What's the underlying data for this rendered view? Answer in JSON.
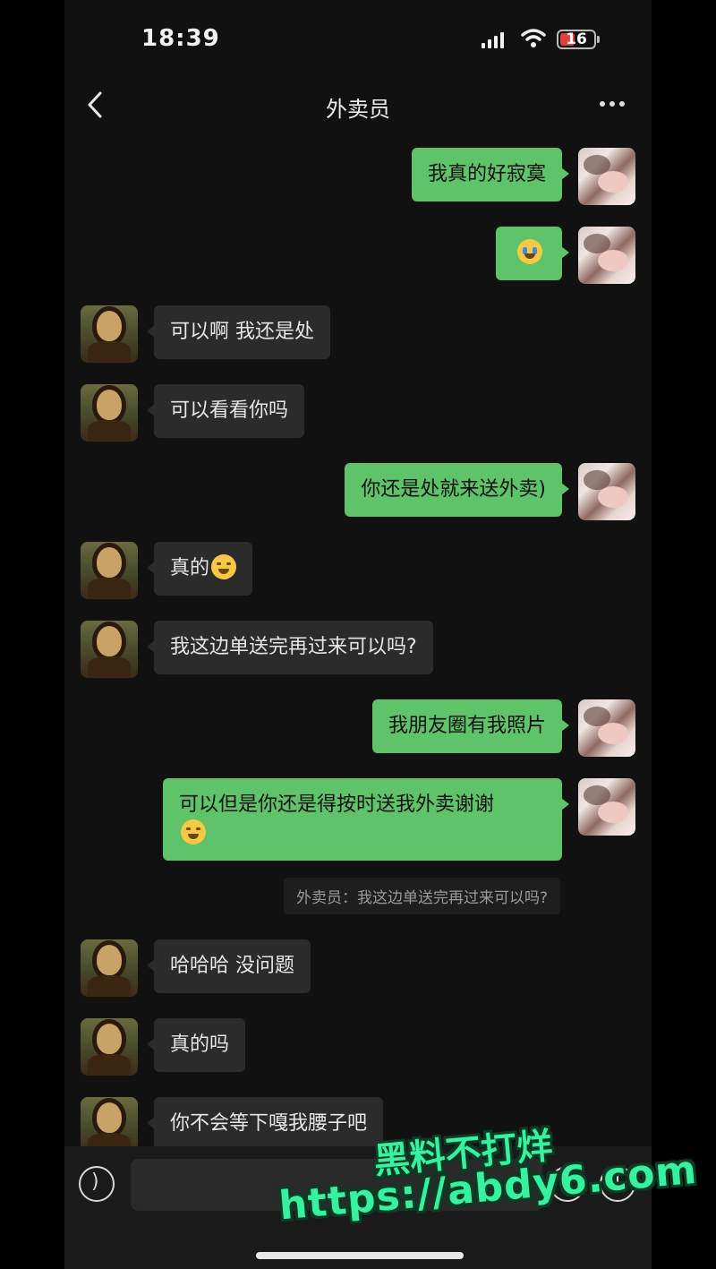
{
  "status_bar": {
    "time": "18:39",
    "battery": "16"
  },
  "nav": {
    "title": "外卖员"
  },
  "messages": [
    {
      "from": "self",
      "text": "我真的好寂寞"
    },
    {
      "from": "self",
      "emoji": "crying-emoji"
    },
    {
      "from": "other",
      "text": "可以啊 我还是处"
    },
    {
      "from": "other",
      "text": "可以看看你吗"
    },
    {
      "from": "self",
      "text": "你还是处就来送外卖)"
    },
    {
      "from": "other",
      "text": "真的",
      "emoji": "grin-sweat-emoji"
    },
    {
      "from": "other",
      "text": "我这边单送完再过来可以吗?"
    },
    {
      "from": "self",
      "text": "我朋友圈有我照片"
    },
    {
      "from": "self",
      "text": "可以但是你还是得按时送我外卖谢谢",
      "emoji": "smiling-emoji"
    },
    {
      "from": "other",
      "text": "哈哈哈 没问题"
    },
    {
      "from": "other",
      "text": "真的吗"
    },
    {
      "from": "other",
      "text": "你不会等下嘎我腰子吧"
    }
  ],
  "quote": {
    "text": "外卖员：我这边单送完再过来可以吗?"
  },
  "watermark": {
    "line1": "黑料不打烊",
    "line2": "https://abdy6.com"
  }
}
